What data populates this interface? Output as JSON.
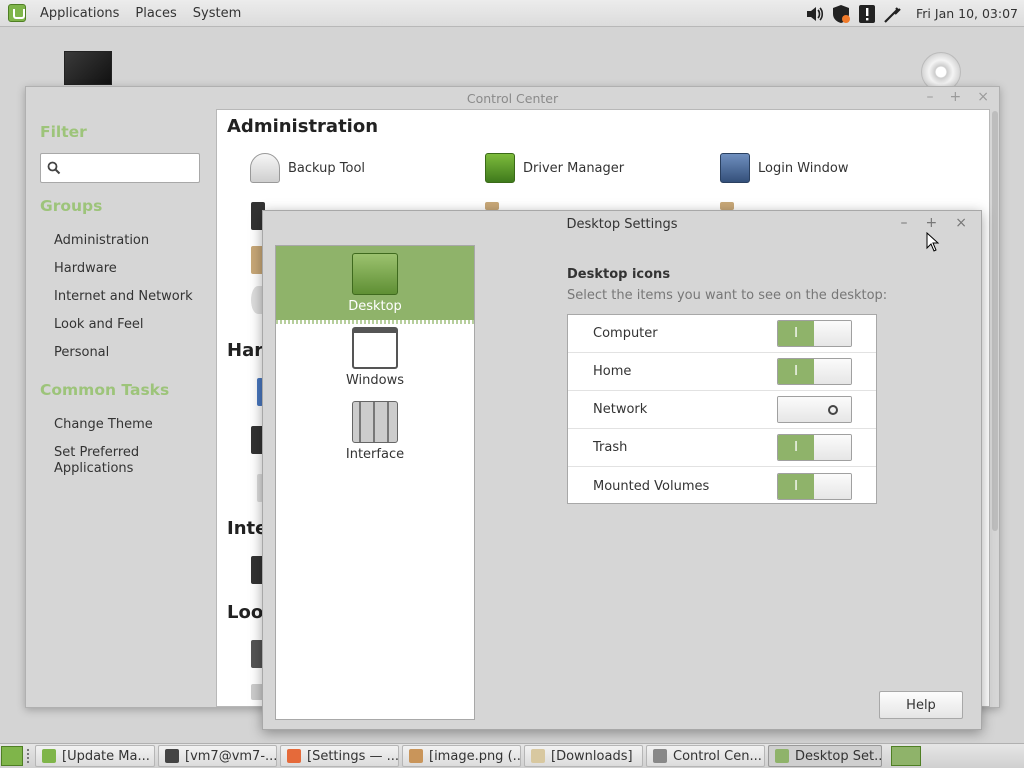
{
  "top_panel": {
    "menus": [
      "Applications",
      "Places",
      "System"
    ],
    "clock": "Fri Jan 10, 03:07",
    "tray_icons": [
      "volume-icon",
      "shield-update-icon",
      "notification-icon",
      "network-icon"
    ]
  },
  "control_center": {
    "title": "Control Center",
    "filter_heading": "Filter",
    "search_value": "",
    "groups_heading": "Groups",
    "groups": [
      "Administration",
      "Hardware",
      "Internet and Network",
      "Look and Feel",
      "Personal"
    ],
    "tasks_heading": "Common Tasks",
    "tasks": [
      "Change Theme",
      "Set Preferred\nApplications"
    ],
    "sections": [
      "Administration",
      "Hard",
      "Inte",
      "Loo"
    ],
    "admin_tools": [
      {
        "label": "Backup Tool",
        "icon": "backup-tool-icon"
      },
      {
        "label": "Driver Manager",
        "icon": "driver-manager-icon"
      },
      {
        "label": "Login Window",
        "icon": "login-window-icon"
      }
    ]
  },
  "desktop_settings": {
    "title": "Desktop Settings",
    "nav": [
      {
        "label": "Desktop",
        "selected": true
      },
      {
        "label": "Windows",
        "selected": false
      },
      {
        "label": "Interface",
        "selected": false
      }
    ],
    "heading": "Desktop icons",
    "subtitle": "Select the items you want to see on the desktop:",
    "items": [
      {
        "label": "Computer",
        "enabled": true
      },
      {
        "label": "Home",
        "enabled": true
      },
      {
        "label": "Network",
        "enabled": false
      },
      {
        "label": "Trash",
        "enabled": true
      },
      {
        "label": "Mounted Volumes",
        "enabled": true
      }
    ],
    "on_glyph": "I",
    "help_label": "Help"
  },
  "taskbar": {
    "items": [
      {
        "label": "[Update Ma...",
        "icon": "update-manager-icon",
        "active": false
      },
      {
        "label": "[vm7@vm7-...",
        "icon": "terminal-icon",
        "active": false
      },
      {
        "label": "[Settings — ...",
        "icon": "settings-app-icon",
        "active": false
      },
      {
        "label": "[image.png (...",
        "icon": "image-viewer-icon",
        "active": false
      },
      {
        "label": "[Downloads]",
        "icon": "folder-icon",
        "active": false
      },
      {
        "label": "Control Cen...",
        "icon": "control-center-icon",
        "active": false
      },
      {
        "label": "Desktop Set...",
        "icon": "desktop-settings-icon",
        "active": true
      }
    ]
  },
  "colors": {
    "accent": "#8fb36a",
    "heading_green": "#9dc47a"
  }
}
